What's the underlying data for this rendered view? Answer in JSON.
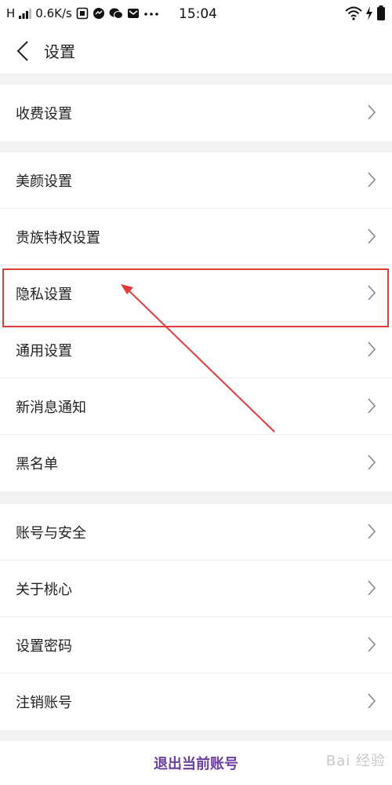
{
  "status_bar": {
    "signal_text": "H",
    "speed": "0.6K/s",
    "time": "15:04",
    "icons": [
      "signal-bars-icon",
      "notification-icon",
      "messenger-icon",
      "wechat-icon",
      "mail-icon",
      "more-icon",
      "wifi-icon",
      "charging-icon",
      "battery-icon"
    ]
  },
  "nav": {
    "title": "设置",
    "back_icon": "chevron-left-icon"
  },
  "groups": [
    {
      "items": [
        {
          "label": "收费设置"
        }
      ]
    },
    {
      "items": [
        {
          "label": "美颜设置"
        },
        {
          "label": "贵族特权设置"
        },
        {
          "label": "隐私设置"
        },
        {
          "label": "通用设置"
        },
        {
          "label": "新消息通知"
        },
        {
          "label": "黑名单"
        }
      ]
    },
    {
      "items": [
        {
          "label": "账号与安全"
        },
        {
          "label": "关于桃心"
        },
        {
          "label": "设置密码"
        },
        {
          "label": "注销账号"
        }
      ]
    }
  ],
  "logout_label": "退出当前账号",
  "watermark": "Bai 经验",
  "colors": {
    "accent": "#6a3fa0",
    "annotation": "#e23b3b",
    "background": "#f2f2f2"
  }
}
